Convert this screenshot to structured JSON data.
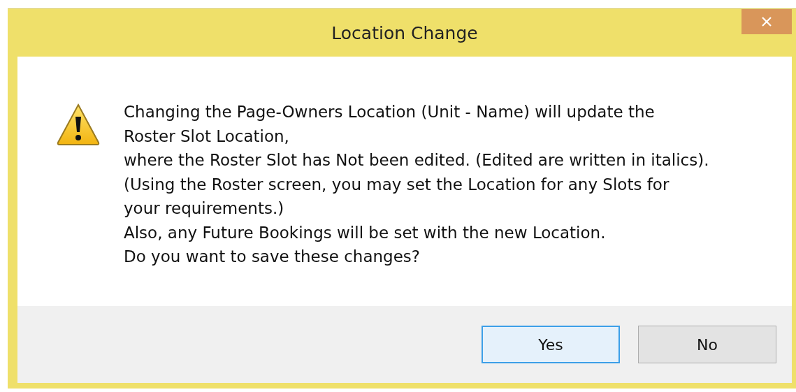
{
  "window": {
    "title": "Location Change"
  },
  "message": {
    "kind": "warning",
    "lines": [
      "Changing the Page-Owners Location (Unit - Name) will update the",
      "Roster Slot Location,",
      "where the Roster Slot has Not been edited. (Edited are written in italics).",
      "(Using the Roster screen, you may set the Location for any Slots for",
      "your requirements.)",
      "Also, any Future Bookings will be set with the new Location.",
      "Do you want to save these changes?"
    ]
  },
  "buttons": [
    {
      "label": "Yes",
      "focused": true
    },
    {
      "label": "No",
      "focused": false
    }
  ]
}
